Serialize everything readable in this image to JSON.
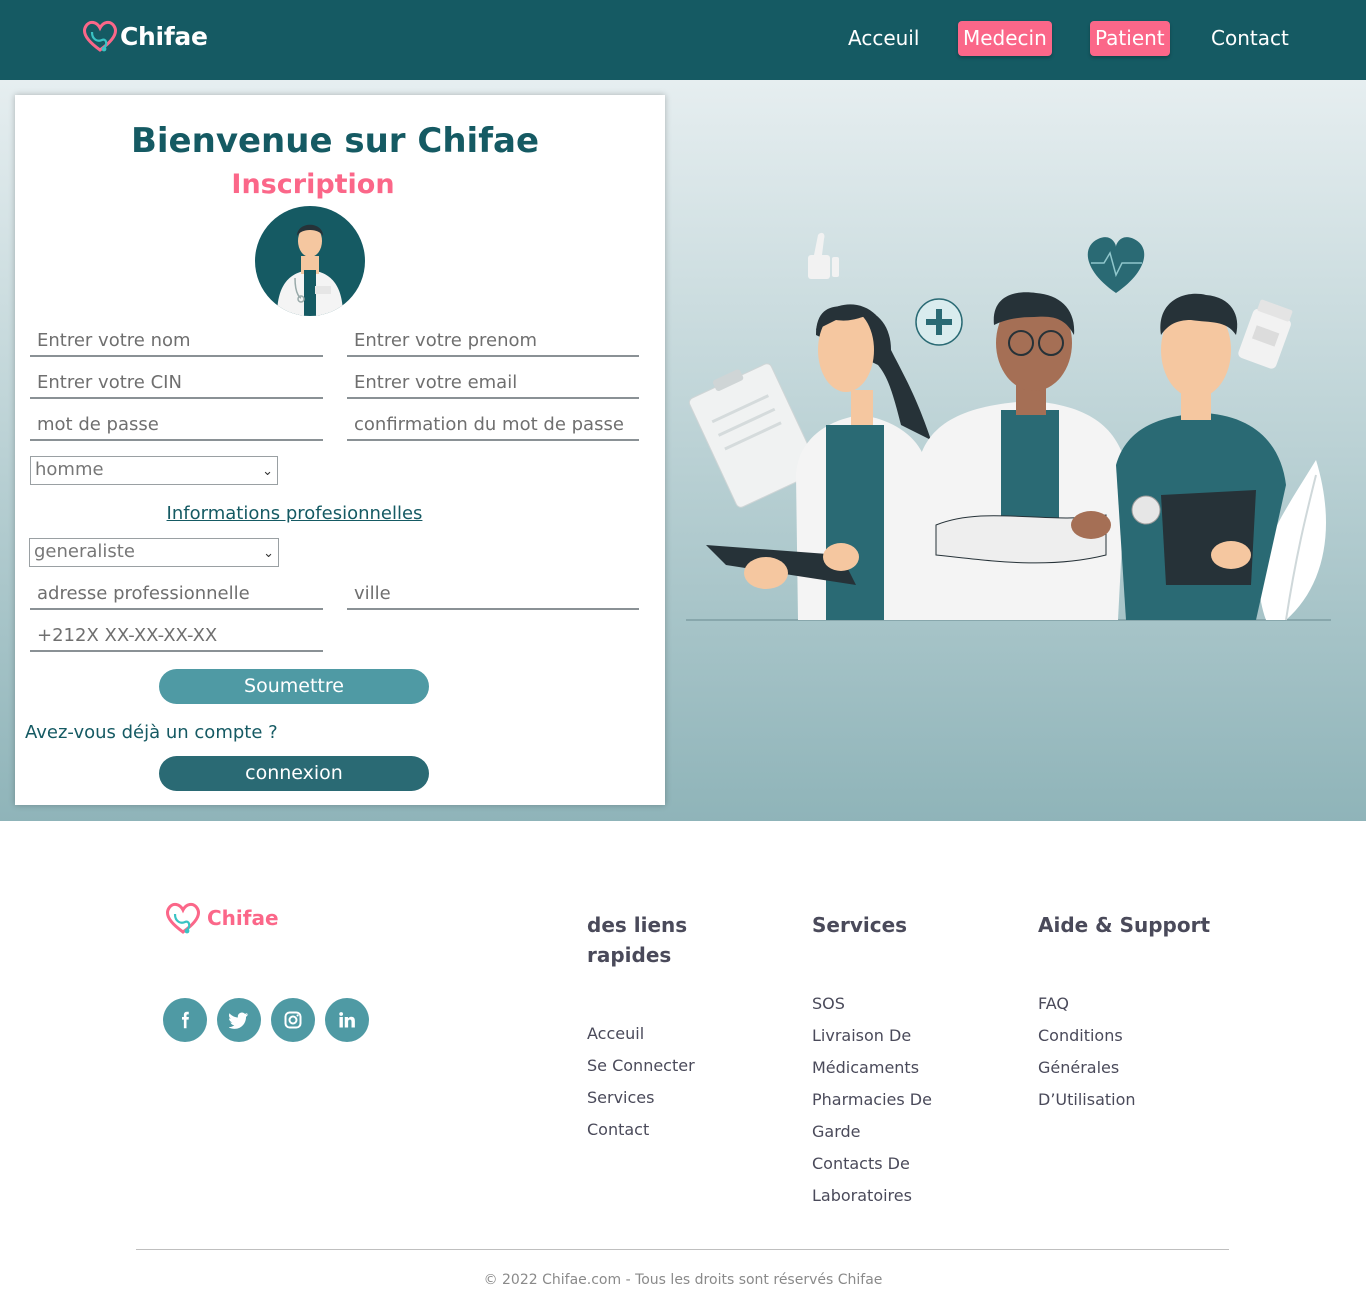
{
  "brand": {
    "name": "Chifae",
    "primary": "#155a63",
    "accent": "#fb6789",
    "button": "#4f9aa4"
  },
  "nav": {
    "links": [
      {
        "label": "Acceuil",
        "style": "plain"
      },
      {
        "label": "Medecin",
        "style": "pill"
      },
      {
        "label": "Patient",
        "style": "pill"
      },
      {
        "label": "Contact",
        "style": "plain"
      }
    ]
  },
  "form": {
    "welcome": "Bienvenue sur Chifae",
    "subtitle": "Inscription",
    "avatar_icon": "doctor-avatar-icon",
    "placeholders": {
      "nom": "Entrer votre nom",
      "prenom": "Entrer votre prenom",
      "cin": "Entrer votre CIN",
      "email": "Entrer votre email",
      "password": "mot de passe",
      "password_confirm": "confirmation du mot de passe",
      "address": "adresse professionnelle",
      "city": "ville",
      "phone": "+212X XX-XX-XX-XX"
    },
    "gender_select": "homme",
    "prof_link": "Informations profesionnelles",
    "specialty_select": "generaliste",
    "submit": "Soumettre",
    "have_account": "Avez-vous déjà un compte ?",
    "login": "connexion"
  },
  "footer": {
    "brand": "Chifae",
    "socials": [
      "facebook-icon",
      "twitter-icon",
      "instagram-icon",
      "linkedin-icon"
    ],
    "columns": [
      {
        "title": "des liens rapides",
        "items": [
          "Acceuil",
          "Se Connecter",
          "Services",
          "Contact"
        ]
      },
      {
        "title": "Services",
        "items": [
          "SOS",
          "Livraison De",
          "Médicaments",
          "Pharmacies De",
          "Garde",
          "Contacts De",
          "Laboratoires"
        ]
      },
      {
        "title": "Aide & Support",
        "items": [
          "FAQ",
          "Conditions",
          "Générales",
          "D’Utilisation"
        ]
      }
    ],
    "copyright": "© 2022 Chifae.com - Tous les droits sont réservés Chifae"
  }
}
